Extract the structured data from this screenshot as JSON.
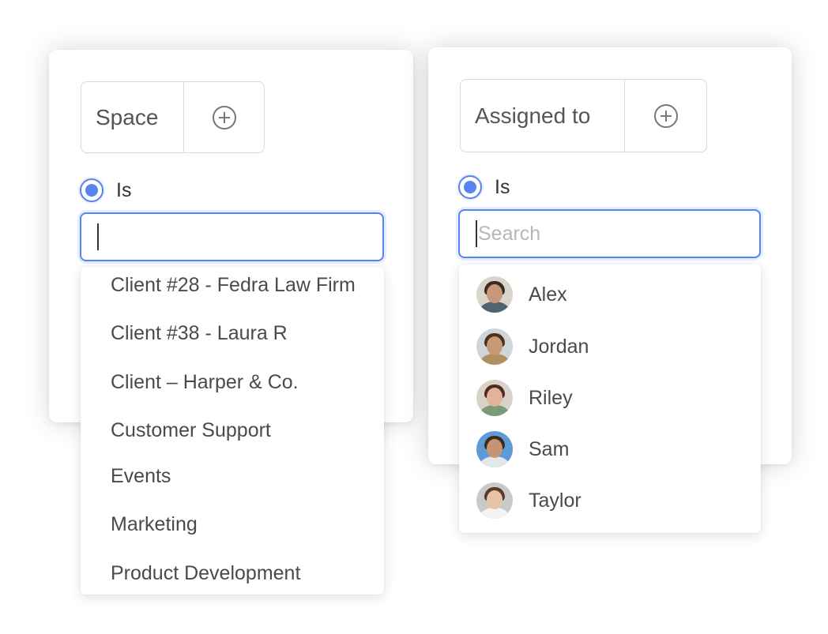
{
  "space_panel": {
    "field_label": "Space",
    "condition_label": "Is",
    "search_value": "",
    "options": [
      "Client #28 - Fedra Law Firm",
      "Client #38 - Laura R",
      "Client – Harper & Co.",
      "Customer Support",
      "Events",
      "Marketing",
      "Product Development"
    ]
  },
  "assigned_panel": {
    "field_label": "Assigned to",
    "condition_label": "Is",
    "search_placeholder": "Search",
    "people": [
      {
        "name": "Alex",
        "skin": "#c99878",
        "hair": "#3b2a20",
        "shirt": "#4f6470",
        "bg": "#d9d4cc"
      },
      {
        "name": "Jordan",
        "skin": "#c99a72",
        "hair": "#4a3020",
        "shirt": "#b08f62",
        "bg": "#cfd6d9"
      },
      {
        "name": "Riley",
        "skin": "#e0b39a",
        "hair": "#4e2d1e",
        "shirt": "#7a9a78",
        "bg": "#d8d2c8"
      },
      {
        "name": "Sam",
        "skin": "#c59474",
        "hair": "#3a2a22",
        "shirt": "#e4e7ea",
        "bg": "#5d9bd8"
      },
      {
        "name": "Taylor",
        "skin": "#e7c3a6",
        "hair": "#5a3c26",
        "shirt": "#f3f3f3",
        "bg": "#c9c9c9"
      }
    ]
  },
  "colors": {
    "accent": "#5b83f0",
    "border": "#d9d9d9",
    "text": "#4a4a4a"
  },
  "icons": {
    "add": "plus-circle-icon",
    "radio": "radio-selected-icon"
  }
}
